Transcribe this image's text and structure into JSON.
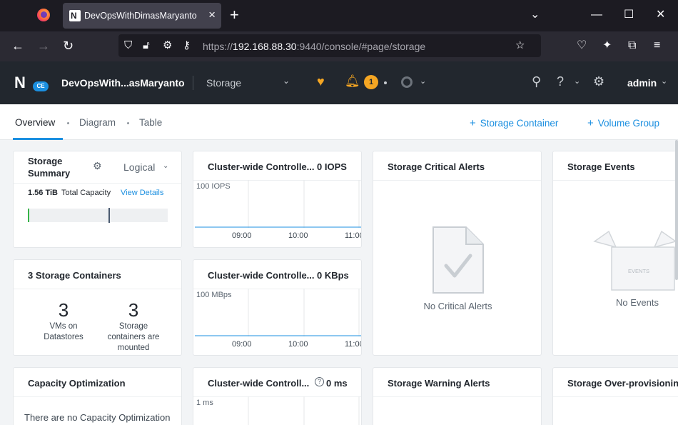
{
  "browser": {
    "tab_title": "DevOpsWithDimasMaryanto - N",
    "tab_favicon": "N",
    "url_prefix": "https://",
    "url_host": "192.168.88.30",
    "url_rest": ":9440/console/#page/storage"
  },
  "header": {
    "logo_letter": "N",
    "logo_badge": "CE",
    "cluster_name": "DevOpsWith...asMaryanto",
    "page_select": "Storage",
    "alert_count": "1",
    "user": "admin"
  },
  "subnav": {
    "tabs": [
      "Overview",
      "Diagram",
      "Table"
    ],
    "actions": [
      "Storage Container",
      "Volume Group"
    ]
  },
  "cards": {
    "summary": {
      "title_line1": "Storage",
      "title_line2": "Summary",
      "view_mode": "Logical",
      "capacity_value": "1.56 TiB",
      "capacity_label": "Total Capacity",
      "view_details": "View Details"
    },
    "iops": {
      "title": "Cluster-wide Controlle...",
      "value": "0 IOPS",
      "ylabel": "100 IOPS",
      "x_ticks": [
        "09:00",
        "10:00",
        "11:00"
      ]
    },
    "bandwidth": {
      "title": "Cluster-wide Controlle...",
      "value": "0 KBps",
      "ylabel": "100 MBps",
      "x_ticks": [
        "09:00",
        "10:00",
        "11:00"
      ]
    },
    "latency": {
      "title": "Cluster-wide Controll...",
      "value": "0 ms",
      "ylabel": "1 ms"
    },
    "containers": {
      "title": "3 Storage Containers",
      "stat1_value": "3",
      "stat1_label": "VMs on Datastores",
      "stat2_value": "3",
      "stat2_label": "Storage containers are mounted"
    },
    "critical_alerts": {
      "title": "Storage Critical Alerts",
      "empty": "No Critical Alerts"
    },
    "events": {
      "title": "Storage Events",
      "empty": "No Events",
      "box_label": "EVENTS"
    },
    "capacity_opt": {
      "title": "Capacity Optimization",
      "message": "There are no Capacity Optimization"
    },
    "warning_alerts": {
      "title": "Storage Warning Alerts"
    },
    "overprovisioning": {
      "title": "Storage Over-provisioning"
    }
  },
  "colors": {
    "accent": "#1b8fe0",
    "alert": "#f5a623",
    "header_bg": "#22272e",
    "usage": "#38b449"
  }
}
